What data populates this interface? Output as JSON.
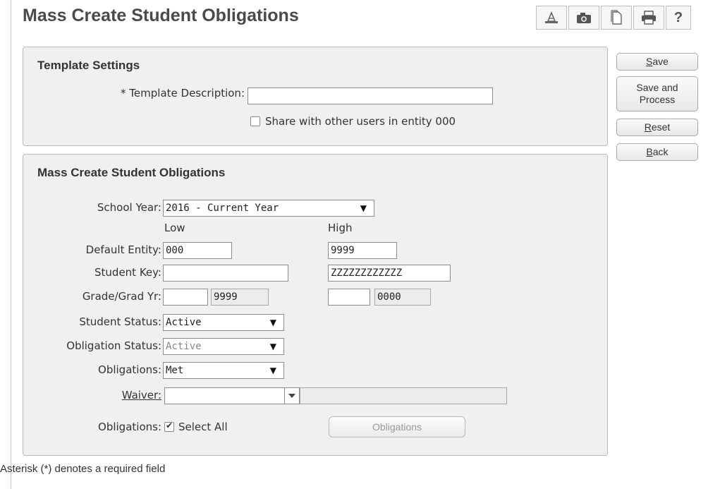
{
  "page": {
    "title": "Mass Create Student Obligations"
  },
  "toolbar": {
    "icons": [
      "report-icon",
      "camera-icon",
      "page-icon",
      "print-icon"
    ],
    "help_label": "?"
  },
  "template_settings": {
    "title": "Template Settings",
    "description_label": "* Template Description:",
    "description_value": "",
    "share_label": "Share with other users in entity 000",
    "share_checked": false
  },
  "mass_create": {
    "title": "Mass Create Student Obligations",
    "school_year": {
      "label": "School Year:",
      "value": "2016 - Current Year"
    },
    "low_header": "Low",
    "high_header": "High",
    "default_entity": {
      "label": "Default Entity:",
      "low": "000",
      "high": "9999"
    },
    "student_key": {
      "label": "Student Key:",
      "low": "",
      "high": "ZZZZZZZZZZZZ"
    },
    "grade_grad_yr": {
      "label": "Grade/Grad Yr:",
      "low_grade": "",
      "low_year": "9999",
      "high_grade": "",
      "high_year": "0000"
    },
    "student_status": {
      "label": "Student Status:",
      "value": "Active"
    },
    "obligation_status": {
      "label": "Obligation Status:",
      "value": "Active"
    },
    "obligations_filter": {
      "label": "Obligations:",
      "value": "Met"
    },
    "waiver": {
      "label": "Waiver:",
      "value": "",
      "description": ""
    },
    "select_all": {
      "label": "Obligations:",
      "checkbox_label": "Select All",
      "checked": true,
      "button_label": "Obligations"
    }
  },
  "buttons": {
    "save": {
      "u": "S",
      "rest": "ave"
    },
    "save_and_process": {
      "line1": "Save and",
      "line2": "Process"
    },
    "reset": {
      "u": "R",
      "rest": "eset"
    },
    "back": {
      "u": "B",
      "rest": "ack"
    }
  },
  "footer": "Asterisk (*) denotes a required field"
}
